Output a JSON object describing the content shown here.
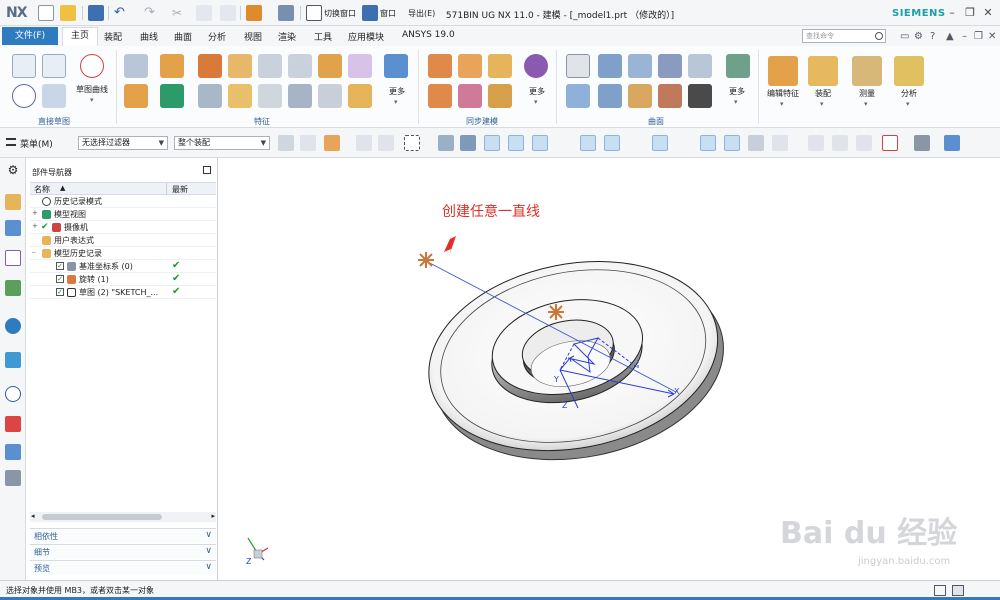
{
  "app": {
    "logo": "NX",
    "title": "571BIN UG NX 11.0 - 建模 - [_model1.prt （修改的）]",
    "brand": "SIEMENS",
    "quick_access": {
      "switch_window": "切换窗口",
      "window": "窗口",
      "export": "导出(E)"
    }
  },
  "tabs": {
    "file": "文件(F)",
    "items": [
      "主页",
      "装配",
      "曲线",
      "曲面",
      "分析",
      "视图",
      "渲染",
      "工具",
      "应用模块",
      "ANSYS 19.0"
    ],
    "active_index": 0,
    "search_placeholder": "查找命令"
  },
  "ribbon": {
    "groups": {
      "direct_sketch": "直接草图",
      "feature": "特征",
      "sync": "同步建模",
      "surface": "曲面"
    },
    "labels": {
      "sketch_curve": "草图曲线",
      "more1": "更多",
      "more2": "更多",
      "more3": "更多",
      "edit_feature": "编辑特征",
      "assembly": "装配",
      "measure": "测量",
      "analysis": "分析"
    }
  },
  "selbar": {
    "menu": "菜单(M)",
    "filter": "无选择过滤器",
    "scope": "整个装配"
  },
  "navigator": {
    "title": "部件导航器",
    "col_name": "名称",
    "col_latest": "最新",
    "rows": [
      {
        "label": "历史记录模式"
      },
      {
        "label": "模型视图"
      },
      {
        "label": "摄像机"
      },
      {
        "label": "用户表达式"
      },
      {
        "label": "模型历史记录"
      },
      {
        "label": "基准坐标系 (0)",
        "ok": "✔"
      },
      {
        "label": "旋转 (1)",
        "ok": "✔"
      },
      {
        "label": "草图 (2) \"SKETCH_...",
        "ok": "✔"
      }
    ],
    "panels": [
      "相依性",
      "细节",
      "预览"
    ]
  },
  "graphics": {
    "annotation": "创建任意一直线",
    "sketch_axis_x": "X",
    "sketch_axis_y": "Y",
    "sketch_axis_z": "Z",
    "triad_label": "Z"
  },
  "status": {
    "text": "选择对象并使用 MB3，或者双击某一对象"
  },
  "watermark": {
    "logo": "Bai du 经验",
    "url": "jingyan.baidu.com"
  }
}
